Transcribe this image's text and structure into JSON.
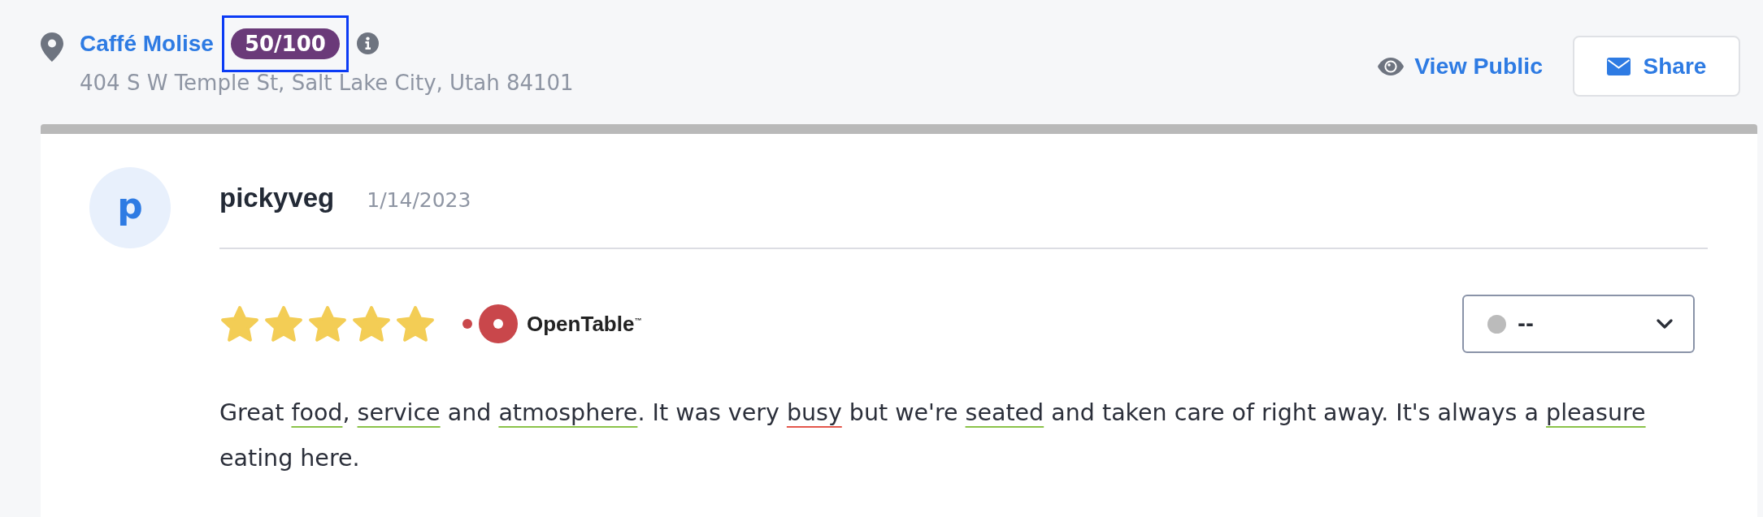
{
  "place": {
    "name": "Caffé Molise",
    "score": {
      "label": "50/100",
      "highlighted": true
    },
    "address": "404 S W Temple St, Salt Lake City, Utah 84101"
  },
  "actions": [
    {
      "kind": "link",
      "label": "View Public"
    },
    {
      "kind": "button",
      "label": "Share"
    }
  ],
  "review": {
    "avatar_initial": "p",
    "author": "pickyveg",
    "date": "1/14/2023",
    "stars": 5,
    "source": "OpenTable$^{™}$",
    "status_select": {
      "value": "--",
      "color": "#bbbbbb"
    },
    "text": [
      {
        "kind": "plain",
        "text": "Great "
      },
      {
        "kind": "positive",
        "text": "food"
      },
      {
        "kind": "plain",
        "text": ", "
      },
      {
        "kind": "positive",
        "text": "service"
      },
      {
        "kind": "plain",
        "text": " and "
      },
      {
        "kind": "positive",
        "text": "atmosphere"
      },
      {
        "kind": "plain",
        "text": ". It was very "
      },
      {
        "kind": "negative",
        "text": "busy"
      },
      {
        "kind": "plain",
        "text": " but we're "
      },
      {
        "kind": "positive",
        "text": "seated"
      },
      {
        "kind": "plain",
        "text": " and taken care of right away. It's always a "
      },
      {
        "kind": "positive",
        "text": "pleasure"
      },
      {
        "kind": "plain",
        "text": " eating here."
      }
    ]
  }
}
